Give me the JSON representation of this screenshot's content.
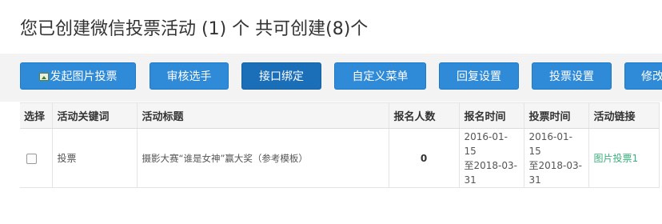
{
  "header": {
    "title": "您已创建微信投票活动 (1) 个 共可创建(8)个"
  },
  "toolbar": {
    "buttons": [
      {
        "label": "发起图片投票",
        "icon": "picture-icon"
      },
      {
        "label": "审核选手"
      },
      {
        "label": "接口绑定"
      },
      {
        "label": "自定义菜单"
      },
      {
        "label": "回复设置"
      },
      {
        "label": "投票设置"
      },
      {
        "label": "修改"
      }
    ],
    "colors": {
      "button": "#2f8ad8",
      "button_active": "#1b6fb8"
    }
  },
  "table": {
    "headers": [
      "选择",
      "活动关键词",
      "活动标题",
      "报名人数",
      "报名时间",
      "投票时间",
      "活动链接"
    ],
    "rows": [
      {
        "keyword": "投票",
        "title": "摄影大赛“谁是女神”赢大奖（参考模板）",
        "signups": "0",
        "signup_time_1": "2016-01-15",
        "signup_time_2": "至2018-03-",
        "signup_time_3": "31",
        "vote_time_1": "2016-01-15",
        "vote_time_2": "至2018-03-",
        "vote_time_3": "31",
        "link": "图片投票1"
      }
    ],
    "link_color": "#3bb07c"
  }
}
